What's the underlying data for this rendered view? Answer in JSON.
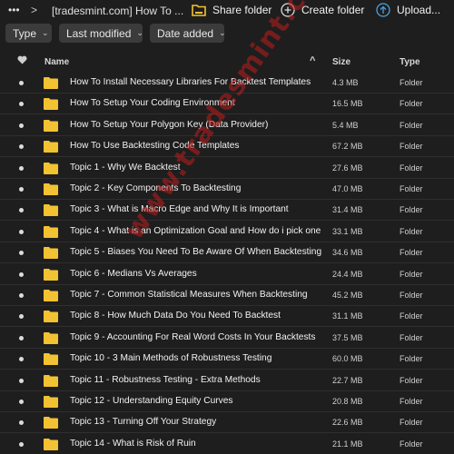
{
  "toolbar": {
    "more_icon": "more-horizontal-icon",
    "breadcrumb": "[tradesmint.com] How To ...",
    "share_label": "Share folder",
    "create_label": "Create folder",
    "upload_label": "Upload..."
  },
  "filters": {
    "type_label": "Type",
    "modified_label": "Last modified",
    "date_added_label": "Date added"
  },
  "columns": {
    "name": "Name",
    "size": "Size",
    "type": "Type"
  },
  "rows": [
    {
      "name": "How To Install Necessary Libraries For Backtest Templates",
      "size": "4.3 MB",
      "type": "Folder"
    },
    {
      "name": "How To Setup Your Coding Environment",
      "size": "16.5 MB",
      "type": "Folder"
    },
    {
      "name": "How To Setup Your Polygon Key (Data Provider)",
      "size": "5.4 MB",
      "type": "Folder"
    },
    {
      "name": "How To Use Backtesting Code Templates",
      "size": "67.2 MB",
      "type": "Folder"
    },
    {
      "name": "Topic 1 - Why We Backtest",
      "size": "27.6 MB",
      "type": "Folder"
    },
    {
      "name": "Topic 2 - Key Components To Backtesting",
      "size": "47.0 MB",
      "type": "Folder"
    },
    {
      "name": "Topic 3 - What is Macro Edge and Why It is Important",
      "size": "31.4 MB",
      "type": "Folder"
    },
    {
      "name": "Topic 4 - What is an Optimization Goal and How do i pick one",
      "size": "33.1 MB",
      "type": "Folder"
    },
    {
      "name": "Topic 5 - Biases You Need To Be Aware Of When Backtesting",
      "size": "34.6 MB",
      "type": "Folder"
    },
    {
      "name": "Topic 6 - Medians Vs Averages",
      "size": "24.4 MB",
      "type": "Folder"
    },
    {
      "name": "Topic 7 - Common Statistical Measures When Backtesting",
      "size": "45.2 MB",
      "type": "Folder"
    },
    {
      "name": "Topic 8 - How Much Data Do You Need To Backtest",
      "size": "31.1 MB",
      "type": "Folder"
    },
    {
      "name": "Topic 9 - Accounting For Real Word Costs In Your Backtests",
      "size": "37.5 MB",
      "type": "Folder"
    },
    {
      "name": "Topic 10 - 3 Main Methods of Robustness Testing",
      "size": "60.0 MB",
      "type": "Folder"
    },
    {
      "name": "Topic 11 - Robustness Testing - Extra Methods",
      "size": "22.7 MB",
      "type": "Folder"
    },
    {
      "name": "Topic 12 - Understanding Equity Curves",
      "size": "20.8 MB",
      "type": "Folder"
    },
    {
      "name": "Topic 13 - Turning Off Your Strategy",
      "size": "22.6 MB",
      "type": "Folder"
    },
    {
      "name": "Topic 14 - What is Risk of Ruin",
      "size": "21.1 MB",
      "type": "Folder"
    }
  ],
  "watermark": "www.tradesmint.com",
  "colors": {
    "background": "#1e1e1e",
    "folder": "#f2c232",
    "upload_accent": "#4a9fe0",
    "watermark": "#be1e1e"
  }
}
